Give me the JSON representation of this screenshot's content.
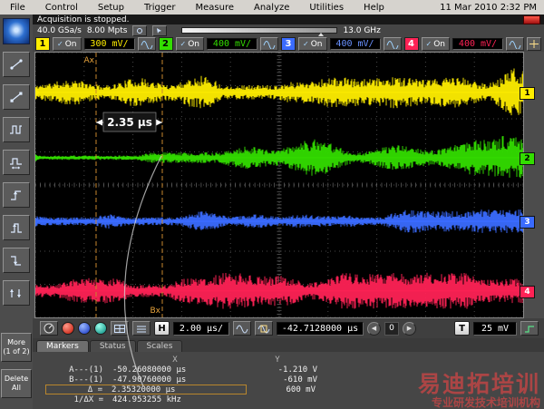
{
  "icons": {
    "check": "✓",
    "left": "◀",
    "right": "▶"
  },
  "menu": {
    "items": [
      "File",
      "Control",
      "Setup",
      "Trigger",
      "Measure",
      "Analyze",
      "Utilities",
      "Help"
    ],
    "datetime": "11 Mar 2010 2:32 PM"
  },
  "status": {
    "acquisition": "Acquisition is stopped.",
    "sample_rate": "40.0 GSa/s",
    "memory": "8.00 Mpts",
    "bandwidth": "13.0 GHz"
  },
  "channels": [
    {
      "num": "1",
      "state": "On",
      "scale": "300 mV/",
      "color": "#ffee00"
    },
    {
      "num": "2",
      "state": "On",
      "scale": "400 mV/",
      "color": "#33dd00"
    },
    {
      "num": "3",
      "state": "On",
      "scale": "400 mV/",
      "color": "#3a6bff"
    },
    {
      "num": "4",
      "state": "On",
      "scale": "400 mV/",
      "color": "#ff2255"
    }
  ],
  "horizontal": {
    "h_label": "H",
    "scale": "2.00 µs/",
    "position": "-42.7128000 µs",
    "zero": "0"
  },
  "trigger": {
    "t_label": "T",
    "level": "25 mV"
  },
  "tabs": [
    {
      "label": "Markers",
      "active": true
    },
    {
      "label": "Status",
      "active": false
    },
    {
      "label": "Scales",
      "active": false
    }
  ],
  "markers_panel": {
    "col_x": "X",
    "col_y": "Y",
    "rows": [
      {
        "label": "A---(1)",
        "x": "-50.26080000 µs",
        "y": "-1.210 V"
      },
      {
        "label": "B---(1)",
        "x": "-47.90760000 µs",
        "y": "-610 mV"
      },
      {
        "label": "Δ =",
        "x": "2.35320000 µs",
        "y": "600 mV"
      },
      {
        "label": "1/ΔX =",
        "x": "424.953255 kHz",
        "y": ""
      }
    ]
  },
  "side_buttons": {
    "more_line1": "More",
    "more_line2": "(1 of 2)",
    "delete_line1": "Delete",
    "delete_line2": "All"
  },
  "watermark": {
    "line1": "易迪拓培训",
    "line2": "专业研发技术培训机构"
  },
  "chart_data": {
    "type": "scope-waveforms",
    "x_scale": "2.00 µs/div",
    "grid": {
      "cols": 10,
      "rows": 8
    },
    "channels": [
      {
        "name": "channel-1",
        "color": "#ffee00",
        "center_frac": 0.15,
        "min_amp": 7,
        "max_amp": 27,
        "seed": 11
      },
      {
        "name": "channel-2",
        "color": "#33dd00",
        "center_frac": 0.397,
        "min_amp": 5,
        "max_amp": 24,
        "seed": 22,
        "quiet_until_frac": 0.205,
        "quiet_amp": 2.5
      },
      {
        "name": "channel-3",
        "color": "#3a6bff",
        "center_frac": 0.637,
        "min_amp": 4,
        "max_amp": 13,
        "seed": 33,
        "baseline": true
      },
      {
        "name": "channel-4",
        "color": "#ff2255",
        "center_frac": 0.9,
        "min_amp": 6,
        "max_amp": 20,
        "seed": 44
      }
    ],
    "markers": {
      "a_label": "Ax",
      "b_label": "Bx",
      "a_x_frac": 0.1245,
      "b_x_frac": 0.2602,
      "delta_text": "2.35 µs"
    }
  }
}
